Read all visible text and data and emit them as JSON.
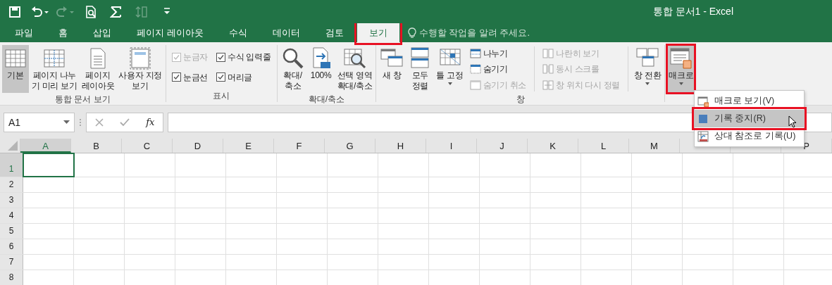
{
  "window": {
    "title": "통합 문서1 - Excel"
  },
  "quick_access": [
    {
      "kind": "save",
      "disabled": false
    },
    {
      "kind": "undo",
      "disabled": false
    },
    {
      "kind": "redo",
      "disabled": true
    },
    {
      "kind": "preview",
      "disabled": false
    },
    {
      "kind": "sum",
      "disabled": false
    },
    {
      "kind": "size",
      "disabled": true
    },
    {
      "kind": "customize",
      "disabled": false
    }
  ],
  "tabs": [
    {
      "label": "파일",
      "selected": false,
      "highlighted": false
    },
    {
      "label": "홈",
      "selected": false,
      "highlighted": false
    },
    {
      "label": "삽입",
      "selected": false,
      "highlighted": false
    },
    {
      "label": "페이지 레이아웃",
      "selected": false,
      "highlighted": false
    },
    {
      "label": "수식",
      "selected": false,
      "highlighted": false
    },
    {
      "label": "데이터",
      "selected": false,
      "highlighted": false
    },
    {
      "label": "검토",
      "selected": false,
      "highlighted": false
    },
    {
      "label": "보기",
      "selected": true,
      "highlighted": true
    }
  ],
  "tell_me": {
    "placeholder": "수행할 작업을 알려 주세요."
  },
  "ribbon": {
    "groups": [
      {
        "label": "통합 문서 보기",
        "items": [
          {
            "kind": "large",
            "label": "기본",
            "selected": true,
            "dropdown": false,
            "highlighted": false
          },
          {
            "kind": "large",
            "label": "페이지 나누\n기 미리 보기",
            "selected": false,
            "dropdown": false,
            "highlighted": false
          },
          {
            "kind": "large",
            "label": "페이지\n레이아웃",
            "selected": false,
            "dropdown": false,
            "highlighted": false
          },
          {
            "kind": "large",
            "label": "사용자 지정\n보기",
            "selected": false,
            "dropdown": false,
            "highlighted": false
          }
        ]
      },
      {
        "label": "표시",
        "items": [
          {
            "kind": "stack",
            "items": [
              {
                "kind": "check",
                "label": "눈금자",
                "checked": true,
                "disabled": true
              },
              {
                "kind": "check",
                "label": "눈금선",
                "checked": true,
                "disabled": false
              }
            ]
          },
          {
            "kind": "stack",
            "items": [
              {
                "kind": "check",
                "label": "수식 입력줄",
                "checked": true,
                "disabled": false
              },
              {
                "kind": "check",
                "label": "머리글",
                "checked": true,
                "disabled": false
              }
            ]
          }
        ]
      },
      {
        "label": "확대/축소",
        "items": [
          {
            "kind": "large",
            "label": "확대/\n축소",
            "selected": false,
            "dropdown": false,
            "highlighted": false
          },
          {
            "kind": "large",
            "label": "100%",
            "selected": false,
            "dropdown": false,
            "highlighted": false
          },
          {
            "kind": "large",
            "label": "선택 영역\n확대/축소",
            "selected": false,
            "dropdown": false,
            "highlighted": false
          }
        ]
      },
      {
        "label": "창",
        "items": [
          {
            "kind": "large",
            "label": "새 창",
            "selected": false,
            "dropdown": false,
            "highlighted": false
          },
          {
            "kind": "large",
            "label": "모두\n정렬",
            "selected": false,
            "dropdown": false,
            "highlighted": false
          },
          {
            "kind": "large",
            "label": "틀 고정",
            "selected": false,
            "dropdown": true,
            "highlighted": false
          },
          {
            "kind": "stack",
            "items": [
              {
                "kind": "small",
                "label": "나누기",
                "disabled": false
              },
              {
                "kind": "small",
                "label": "숨기기",
                "disabled": false
              },
              {
                "kind": "small",
                "label": "숨기기 취소",
                "disabled": true
              }
            ]
          },
          {
            "kind": "separator"
          },
          {
            "kind": "stack",
            "items": [
              {
                "kind": "small",
                "label": "나란히 보기",
                "disabled": true
              },
              {
                "kind": "small",
                "label": "동시 스크롤",
                "disabled": true
              },
              {
                "kind": "small",
                "label": "창 위치 다시 정렬",
                "disabled": true
              }
            ]
          },
          {
            "kind": "separator"
          },
          {
            "kind": "large",
            "label": "창 전환",
            "selected": false,
            "dropdown": true,
            "highlighted": false
          }
        ]
      },
      {
        "items": [
          {
            "kind": "large",
            "label": "매크로",
            "selected": true,
            "dropdown": true,
            "highlighted": true
          }
        ]
      }
    ]
  },
  "formula_bar": {
    "name_box": "A1",
    "function_label": "fx"
  },
  "grid": {
    "columns": [
      {
        "label": "A",
        "selected": true
      },
      {
        "label": "B",
        "selected": false
      },
      {
        "label": "C",
        "selected": false
      },
      {
        "label": "D",
        "selected": false
      },
      {
        "label": "E",
        "selected": false
      },
      {
        "label": "F",
        "selected": false
      },
      {
        "label": "G",
        "selected": false
      },
      {
        "label": "H",
        "selected": false
      },
      {
        "label": "I",
        "selected": false
      },
      {
        "label": "J",
        "selected": false
      },
      {
        "label": "K",
        "selected": false
      },
      {
        "label": "L",
        "selected": false
      },
      {
        "label": "M",
        "selected": false
      },
      {
        "selected": false
      },
      {
        "selected": false
      },
      {
        "label": "P",
        "selected": false
      }
    ],
    "rows": [
      {
        "label": "1",
        "selected": true
      },
      {
        "label": "2",
        "selected": false
      },
      {
        "label": "3",
        "selected": false
      },
      {
        "label": "4",
        "selected": false
      },
      {
        "label": "5",
        "selected": false
      },
      {
        "label": "6",
        "selected": false
      },
      {
        "label": "7",
        "selected": false
      },
      {
        "label": "8",
        "selected": false
      }
    ]
  },
  "macro_menu": {
    "items": [
      {
        "kind": "view",
        "label": "매크로 보기(V)",
        "selected": false,
        "highlighted": false
      },
      {
        "kind": "stop",
        "label": "기록 중지(R)",
        "selected": true,
        "highlighted": true
      },
      {
        "kind": "relative",
        "label": "상대 참조로 기록(U)",
        "selected": false,
        "highlighted": false
      }
    ]
  }
}
